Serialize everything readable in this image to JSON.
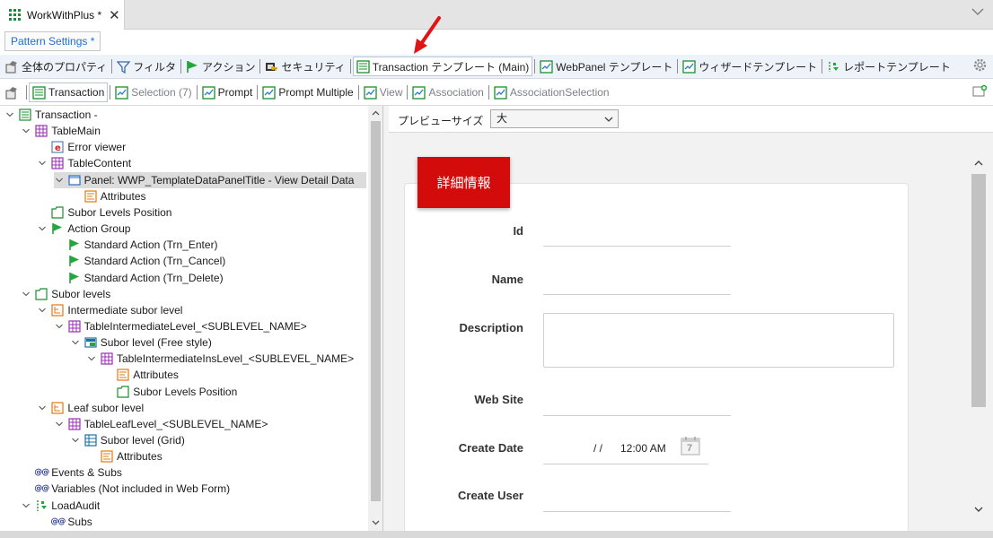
{
  "document_tab": {
    "title": "WorkWithPlus *",
    "close": "✕"
  },
  "pattern_settings_label": "Pattern Settings *",
  "toolbar_main": {
    "items": [
      {
        "label": "全体のプロパティ",
        "icon": "properties-icon"
      },
      {
        "label": "フィルタ",
        "icon": "filter-icon"
      },
      {
        "label": "アクション",
        "icon": "flag-icon"
      },
      {
        "label": "セキュリティ",
        "icon": "security-icon"
      },
      {
        "label": "Transaction テンプレート (Main)",
        "icon": "transaction-template-icon",
        "active": true
      },
      {
        "label": "WebPanel テンプレート",
        "icon": "webpanel-template-icon"
      },
      {
        "label": "ウィザードテンプレート",
        "icon": "wizard-template-icon"
      },
      {
        "label": "レポートテンプレート",
        "icon": "report-template-icon"
      }
    ]
  },
  "toolbar_sub": {
    "items": [
      {
        "label": "Transaction",
        "icon": "transaction-icon",
        "dim": false
      },
      {
        "label": "Selection (7)",
        "icon": "selection-icon",
        "dim": true
      },
      {
        "label": "Prompt",
        "icon": "prompt-icon",
        "dim": false
      },
      {
        "label": "Prompt Multiple",
        "icon": "prompt-multiple-icon",
        "dim": false
      },
      {
        "label": "View",
        "icon": "view-icon",
        "dim": true
      },
      {
        "label": "Association",
        "icon": "association-icon",
        "dim": true
      },
      {
        "label": "AssociationSelection",
        "icon": "association-selection-icon",
        "dim": true
      }
    ]
  },
  "tree": {
    "nodes": [
      {
        "label": "Transaction -",
        "icon": "transaction-node-icon",
        "depth": 0,
        "expanded": true
      },
      {
        "label": "TableMain",
        "icon": "table-icon",
        "depth": 1,
        "expanded": true
      },
      {
        "label": "Error viewer",
        "icon": "error-viewer-icon",
        "depth": 2,
        "expanded": null
      },
      {
        "label": "TableContent",
        "icon": "table-icon",
        "depth": 2,
        "expanded": true
      },
      {
        "label": "Panel: WWP_TemplateDataPanelTitle - View Detail Data",
        "icon": "panel-icon",
        "depth": 3,
        "expanded": true,
        "selected": true
      },
      {
        "label": "Attributes",
        "icon": "attributes-icon",
        "depth": 4,
        "expanded": null
      },
      {
        "label": "Subor Levels Position",
        "icon": "position-icon",
        "depth": 2,
        "expanded": null
      },
      {
        "label": "Action Group",
        "icon": "flag-icon",
        "depth": 2,
        "expanded": true
      },
      {
        "label": "Standard Action (Trn_Enter)",
        "icon": "flag-icon",
        "depth": 3,
        "expanded": null
      },
      {
        "label": "Standard Action (Trn_Cancel)",
        "icon": "flag-icon",
        "depth": 3,
        "expanded": null
      },
      {
        "label": "Standard Action (Trn_Delete)",
        "icon": "flag-icon",
        "depth": 3,
        "expanded": null
      },
      {
        "label": "Subor levels",
        "icon": "folder-icon",
        "depth": 1,
        "expanded": true
      },
      {
        "label": "Intermediate subor level",
        "icon": "level-icon",
        "depth": 2,
        "expanded": true
      },
      {
        "label": "TableIntermediateLevel_<SUBLEVEL_NAME>",
        "icon": "table-icon",
        "depth": 3,
        "expanded": true
      },
      {
        "label": "Subor level (Free style)",
        "icon": "freestyle-icon",
        "depth": 4,
        "expanded": true
      },
      {
        "label": "TableIntermediateInsLevel_<SUBLEVEL_NAME>",
        "icon": "table-icon",
        "depth": 5,
        "expanded": true
      },
      {
        "label": "Attributes",
        "icon": "attributes-icon",
        "depth": 6,
        "expanded": null
      },
      {
        "label": "Subor Levels Position",
        "icon": "position-icon",
        "depth": 6,
        "expanded": null
      },
      {
        "label": "Leaf subor level",
        "icon": "level-icon",
        "depth": 2,
        "expanded": true
      },
      {
        "label": "TableLeafLevel_<SUBLEVEL_NAME>",
        "icon": "table-icon",
        "depth": 3,
        "expanded": true
      },
      {
        "label": "Subor level (Grid)",
        "icon": "grid-level-icon",
        "depth": 4,
        "expanded": true
      },
      {
        "label": "Attributes",
        "icon": "attributes-icon",
        "depth": 5,
        "expanded": null
      },
      {
        "label": "Events & Subs",
        "icon": "events-icon",
        "depth": 1,
        "expanded": null
      },
      {
        "label": "Variables (Not included in Web Form)",
        "icon": "events-icon",
        "depth": 1,
        "expanded": null
      },
      {
        "label": "LoadAudit",
        "icon": "load-audit-icon",
        "depth": 1,
        "expanded": true
      },
      {
        "label": "Subs",
        "icon": "events-icon",
        "depth": 2,
        "expanded": null
      }
    ]
  },
  "preview": {
    "size_label": "プレビューサイズ",
    "size_value": "大",
    "panel_title": "詳細情報",
    "fields": [
      {
        "label": "Id",
        "type": "line"
      },
      {
        "label": "Name",
        "type": "line"
      },
      {
        "label": "Description",
        "type": "box"
      },
      {
        "label": "Web Site",
        "type": "line"
      },
      {
        "label": "Create Date",
        "type": "date",
        "date_value": "/  /",
        "time_value": "12:00 AM",
        "calendar_day": "7"
      },
      {
        "label": "Create User",
        "type": "line"
      }
    ]
  },
  "colors": {
    "accent_red": "#d40b0b",
    "link_blue": "#1b6fd8",
    "tree_green": "#1d8b3c"
  }
}
